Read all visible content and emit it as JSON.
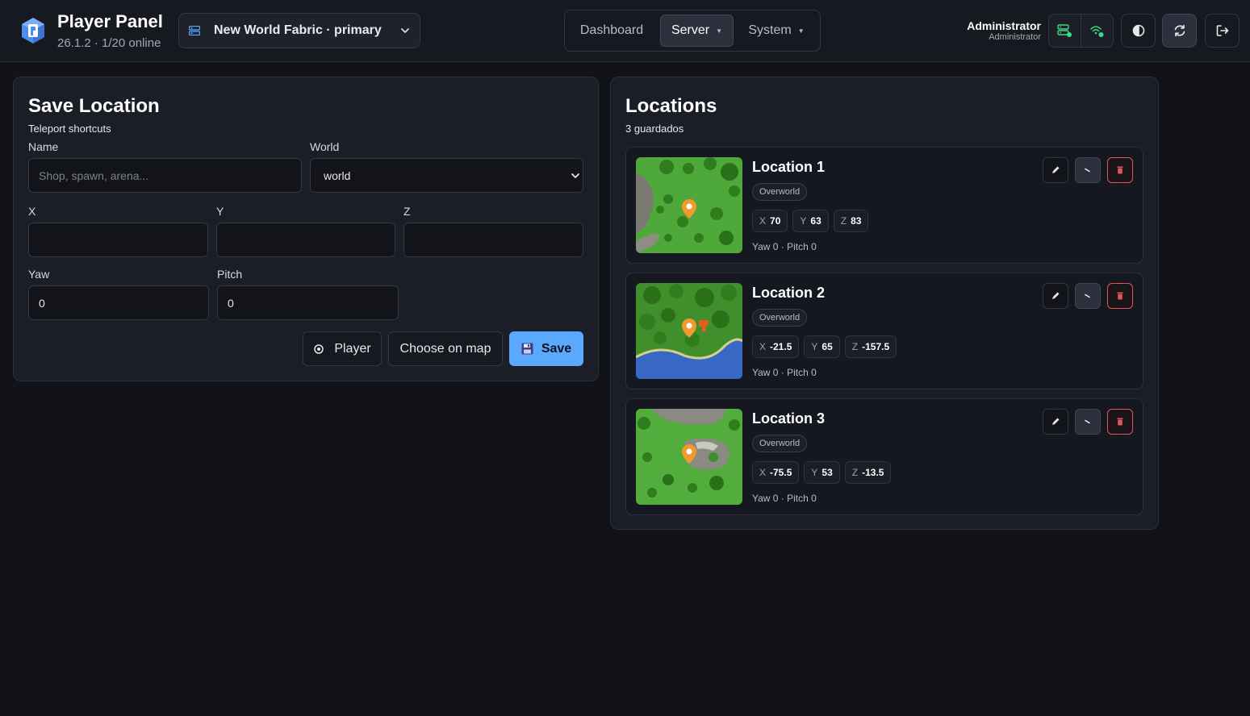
{
  "header": {
    "title": "Player Panel",
    "subtitle": "26.1.2 · 1/20 online",
    "server": "New World Fabric · primary",
    "nav": [
      {
        "label": "Dashboard",
        "active": false,
        "dropdown": false
      },
      {
        "label": "Server",
        "active": true,
        "dropdown": true
      },
      {
        "label": "System",
        "active": false,
        "dropdown": true
      }
    ],
    "user": {
      "name": "Administrator",
      "role": "Administrator"
    },
    "icons": [
      "server-status-icon",
      "network-status-icon",
      "theme-icon",
      "refresh-icon",
      "logout-icon"
    ]
  },
  "form": {
    "title": "Save Location",
    "subtitle": "Teleport shortcuts",
    "name_label": "Name",
    "name_placeholder": "Shop, spawn, arena...",
    "name_value": "",
    "world_label": "World",
    "world_value": "world",
    "x_label": "X",
    "y_label": "Y",
    "z_label": "Z",
    "x_value": "",
    "y_value": "",
    "z_value": "",
    "yaw_label": "Yaw",
    "yaw_value": "0",
    "pitch_label": "Pitch",
    "pitch_value": "0",
    "player_button": "Player",
    "map_button": "Choose on map",
    "save_button": "Save"
  },
  "locations": {
    "title": "Locations",
    "subtitle": "3 guardados",
    "items": [
      {
        "name": "Location 1",
        "dimension": "Overworld",
        "x": "70",
        "y": "63",
        "z": "83",
        "rotation": "Yaw 0 · Pitch 0"
      },
      {
        "name": "Location 2",
        "dimension": "Overworld",
        "x": "-21.5",
        "y": "65",
        "z": "-157.5",
        "rotation": "Yaw 0 · Pitch 0"
      },
      {
        "name": "Location 3",
        "dimension": "Overworld",
        "x": "-75.5",
        "y": "53",
        "z": "-13.5",
        "rotation": "Yaw 0 · Pitch 0"
      }
    ]
  },
  "colors": {
    "accent": "#5aa9ff",
    "background": "#121318",
    "panel": "#1b1e26",
    "danger": "#e0565f",
    "status_online": "#3ddc84",
    "marker": "#f29a2e"
  }
}
